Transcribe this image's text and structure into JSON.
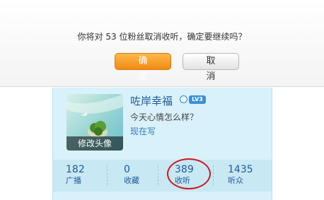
{
  "dialog": {
    "message": "你将对 53 位粉丝取消收听，确定要继续吗？",
    "confirm_label": "确 定",
    "cancel_label": "取 消"
  },
  "profile": {
    "username": "咗岸幸福",
    "level_badge": "LV3",
    "mood": "今天心情怎么样？",
    "write_now": "现在写",
    "avatar_label": "修改头像",
    "stats": [
      {
        "value": "182",
        "label": "广播"
      },
      {
        "value": "0",
        "label": "收藏"
      },
      {
        "value": "389",
        "label": "收听"
      },
      {
        "value": "1435",
        "label": "听众"
      }
    ]
  },
  "colors": {
    "confirm_button": "#f08a12",
    "card_background": "#d9f1fa",
    "link": "#1d5a9a",
    "annotation_circle": "#d0171f"
  }
}
